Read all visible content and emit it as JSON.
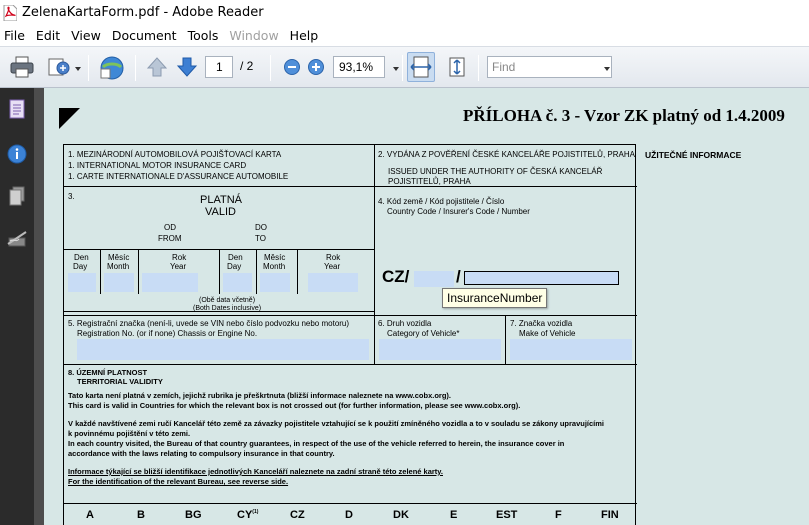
{
  "window": {
    "title": "ZelenaKartaForm.pdf - Adobe Reader"
  },
  "menu": {
    "items": [
      "File",
      "Edit",
      "View",
      "Document",
      "Tools",
      "Window",
      "Help"
    ]
  },
  "toolbar": {
    "page_current": "1",
    "page_total": "/ 2",
    "zoom": "93,1%",
    "find_placeholder": "Find"
  },
  "document": {
    "heading": "PŘÍLOHA č. 3 - Vzor ZK platný od 1.4.2009",
    "useful_info": "UŽITEČNÉ INFORMACE",
    "box1": {
      "line1": "1. MEZINÁRODNÍ AUTOMOBILOVÁ POJIŠŤOVACÍ KARTA",
      "line2": "1. INTERNATIONAL MOTOR INSURANCE CARD",
      "line3": "1. CARTE INTERNATIONALE D'ASSURANCE AUTOMOBILE"
    },
    "box2": {
      "line1": "2. VYDÁNA Z POVĚŘENÍ ČESKÉ KANCELÁŘE POJISTITELŮ, PRAHA",
      "line2": "ISSUED UNDER THE AUTHORITY OF ČESKÁ KANCELÁŘ",
      "line3": "POJISTITELŮ, PRAHA"
    },
    "box3": {
      "num": "3.",
      "valid_cz": "PLATNÁ",
      "valid_en": "VALID",
      "od": "OD",
      "from": "FROM",
      "do": "DO",
      "to": "TO",
      "day_cz": "Den",
      "day_en": "Day",
      "month_cz": "Měsíc",
      "month_en": "Month",
      "year_cz": "Rok",
      "year_en": "Year",
      "both_cz": "(Obě data včetně)",
      "both_en": "(Both Dates inclusive)"
    },
    "box4": {
      "line1": "4. Kód země / Kód pojistitele / Číslo",
      "line2": "Country Code / Insurer's Code / Number",
      "cz": "CZ/",
      "slash": "/",
      "tooltip": "InsuranceNumber"
    },
    "box5": {
      "line1": "5. Registrační značka (není-li, uvede se VIN nebo číslo podvozku nebo motoru)",
      "line2": "Registration No. (or if none) Chassis or Engine No."
    },
    "box6": {
      "line1": "6. Druh vozidla",
      "line2": "Category of Vehicle*"
    },
    "box7": {
      "line1": "7. Značka vozidla",
      "line2": "Make of Vehicle"
    },
    "box8": {
      "line1": "8. ÚZEMNÍ PLATNOST",
      "line2": "TERRITORIAL VALIDITY",
      "p1": "Tato karta není platná v zemích, jejichž rubrika je přeškrtnuta (bližší informace naleznete na www.cobx.org).",
      "p2": "This card is valid in Countries for which the relevant box is not crossed out (for further information, please see www.cobx.org).",
      "p3": "V každé navštívené zemi ručí Kancelář této země za závazky pojistitele vztahující se k použití zmíněného vozidla a to v souladu se zákony upravujícími",
      "p4": "k povinnému pojištění v této zemi.",
      "p5": "In each country visited, the Bureau of that country guarantees, in respect of the use of the vehicle referred to herein, the insurance cover in",
      "p6": "accordance with the laws relating to compulsory insurance in that country.",
      "p7": "Informace týkající se bližší identifikace jednotlivých Kanceláří naleznete na zadní straně této zelené karty.",
      "p8": "For the identification of the relevant Bureau, see reverse side."
    },
    "countries": [
      "A",
      "B",
      "BG",
      "CY",
      "CZ",
      "D",
      "DK",
      "E",
      "EST",
      "F",
      "FIN"
    ],
    "cy_note": "(1)"
  }
}
